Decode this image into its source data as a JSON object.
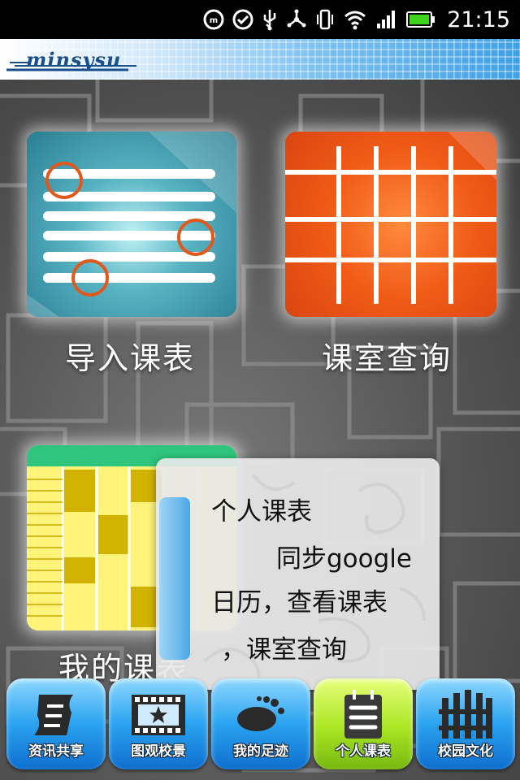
{
  "status_bar": {
    "time": "21:15",
    "icons": [
      "mm-icon",
      "check-circle-icon",
      "usb-icon",
      "usb-tether-icon",
      "vibrate-icon",
      "wifi-icon",
      "signal-icon",
      "battery-icon"
    ]
  },
  "header": {
    "logo_text": "minsysu"
  },
  "tiles": [
    {
      "label": "导入课表",
      "icon": "import-schedule-icon",
      "color": "#2a7d93"
    },
    {
      "label": "课室查询",
      "icon": "classroom-grid-icon",
      "color": "#f05b16"
    },
    {
      "label": "我的课表",
      "icon": "my-timetable-icon",
      "color": "#fff7a4"
    }
  ],
  "tooltip": {
    "line1": "个人课表",
    "line2": "同步google",
    "line3": "日历，查看课表",
    "line4": "，课室查询"
  },
  "tabs": [
    {
      "label": "资讯共享",
      "icon": "scroll-icon",
      "active": false
    },
    {
      "label": "图观校景",
      "icon": "film-star-icon",
      "active": false
    },
    {
      "label": "我的足迹",
      "icon": "footprint-icon",
      "active": false
    },
    {
      "label": "个人课表",
      "icon": "notepad-icon",
      "active": true
    },
    {
      "label": "校园文化",
      "icon": "fence-icon",
      "active": false
    }
  ],
  "colors": {
    "tab_blue": "#2aa3f0",
    "tab_active": "#a9e523"
  }
}
